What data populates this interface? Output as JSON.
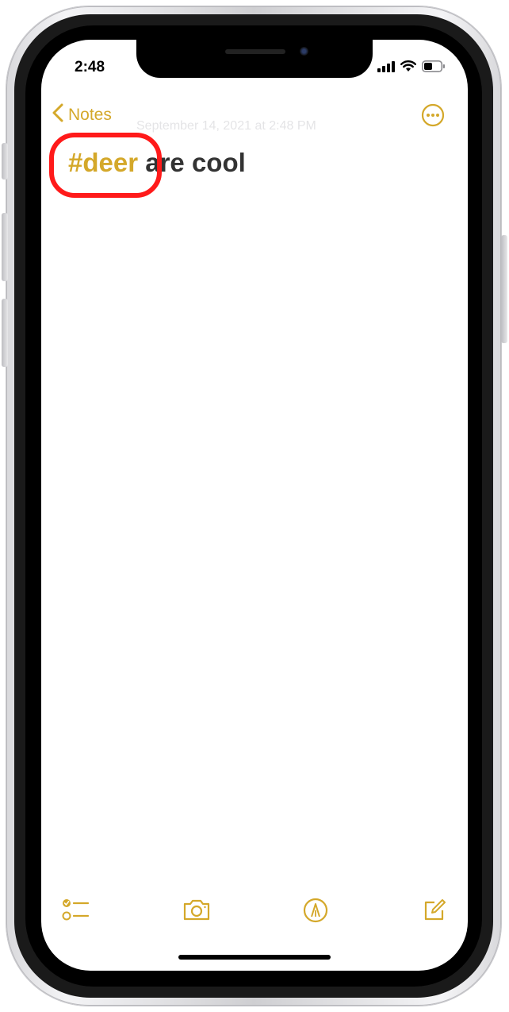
{
  "status_bar": {
    "time": "2:48"
  },
  "nav": {
    "back_label": "Notes",
    "more_icon": "ellipsis-circle-icon"
  },
  "note": {
    "date": "September 14, 2021 at 2:48 PM",
    "tag": "#deer",
    "text": " are cool"
  },
  "toolbar": {
    "icons": [
      "checklist-icon",
      "camera-icon",
      "markup-pen-icon",
      "compose-icon"
    ]
  },
  "colors": {
    "accent": "#d4a82a",
    "highlight": "#ff1a1a",
    "text": "#333333"
  }
}
